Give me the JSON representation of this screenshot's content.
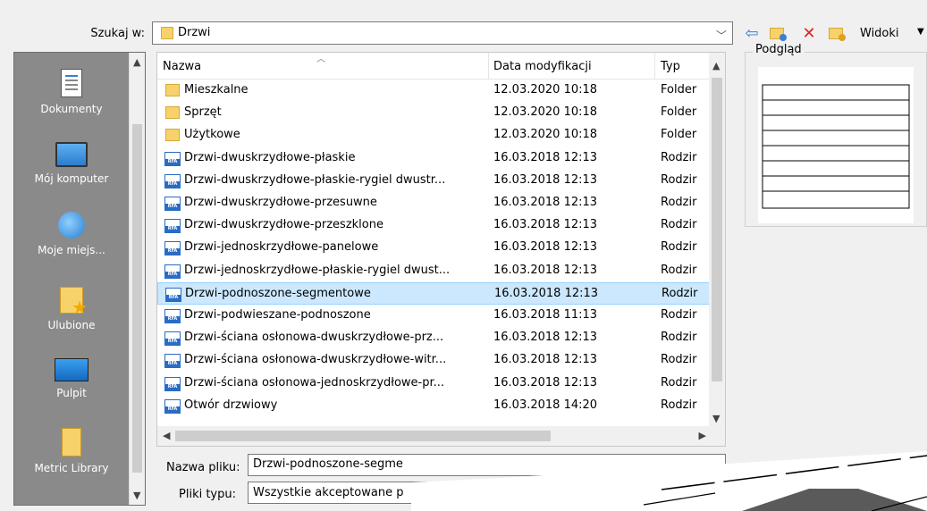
{
  "lookin": {
    "label": "Szukaj w:",
    "value": "Drzwi"
  },
  "toolbar": {
    "views_label": "Widoki"
  },
  "places": [
    {
      "label": "Dokumenty",
      "icon": "documents-icon"
    },
    {
      "label": "Mój komputer",
      "icon": "computer-icon"
    },
    {
      "label": "Moje miejs...",
      "icon": "network-places-icon"
    },
    {
      "label": "Ulubione",
      "icon": "favorites-icon"
    },
    {
      "label": "Pulpit",
      "icon": "desktop-icon"
    },
    {
      "label": "Metric Library",
      "icon": "library-folder-icon"
    }
  ],
  "columns": {
    "name": "Nazwa",
    "date": "Data modyfikacji",
    "type": "Typ"
  },
  "files": [
    {
      "name": "Mieszkalne",
      "date": "12.03.2020 10:18",
      "type": "Folder",
      "kind": "folder"
    },
    {
      "name": "Sprzęt",
      "date": "12.03.2020 10:18",
      "type": "Folder",
      "kind": "folder"
    },
    {
      "name": "Użytkowe",
      "date": "12.03.2020 10:18",
      "type": "Folder",
      "kind": "folder"
    },
    {
      "name": "Drzwi-dwuskrzydłowe-płaskie",
      "date": "16.03.2018 12:13",
      "type": "Rodzir",
      "kind": "rfa"
    },
    {
      "name": "Drzwi-dwuskrzydłowe-płaskie-rygiel dwustr...",
      "date": "16.03.2018 12:13",
      "type": "Rodzir",
      "kind": "rfa"
    },
    {
      "name": "Drzwi-dwuskrzydłowe-przesuwne",
      "date": "16.03.2018 12:13",
      "type": "Rodzir",
      "kind": "rfa"
    },
    {
      "name": "Drzwi-dwuskrzydłowe-przeszklone",
      "date": "16.03.2018 12:13",
      "type": "Rodzir",
      "kind": "rfa"
    },
    {
      "name": "Drzwi-jednoskrzydłowe-panelowe",
      "date": "16.03.2018 12:13",
      "type": "Rodzir",
      "kind": "rfa"
    },
    {
      "name": "Drzwi-jednoskrzydłowe-płaskie-rygiel dwust...",
      "date": "16.03.2018 12:13",
      "type": "Rodzir",
      "kind": "rfa"
    },
    {
      "name": "Drzwi-podnoszone-segmentowe",
      "date": "16.03.2018 12:13",
      "type": "Rodzir",
      "kind": "rfa",
      "selected": true
    },
    {
      "name": "Drzwi-podwieszane-podnoszone",
      "date": "16.03.2018 11:13",
      "type": "Rodzir",
      "kind": "rfa"
    },
    {
      "name": "Drzwi-ściana osłonowa-dwuskrzydłowe-prz...",
      "date": "16.03.2018 12:13",
      "type": "Rodzir",
      "kind": "rfa"
    },
    {
      "name": "Drzwi-ściana osłonowa-dwuskrzydłowe-witr...",
      "date": "16.03.2018 12:13",
      "type": "Rodzir",
      "kind": "rfa"
    },
    {
      "name": "Drzwi-ściana osłonowa-jednoskrzydłowe-pr...",
      "date": "16.03.2018 12:13",
      "type": "Rodzir",
      "kind": "rfa"
    },
    {
      "name": "Otwór drzwiowy",
      "date": "16.03.2018 14:20",
      "type": "Rodzir",
      "kind": "rfa"
    }
  ],
  "preview": {
    "title": "Podgląd"
  },
  "filename": {
    "label": "Nazwa pliku:",
    "value": "Drzwi-podnoszone-segme"
  },
  "filetype": {
    "label": "Pliki typu:",
    "value": "Wszystkie akceptowane p"
  }
}
